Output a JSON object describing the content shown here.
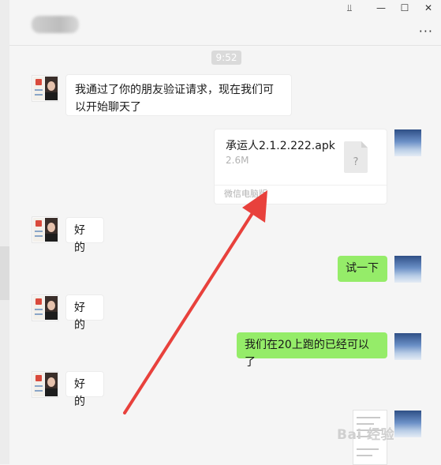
{
  "window": {
    "title": "",
    "controls": {
      "pin": "⫫",
      "minimize": "—",
      "maximize": "☐",
      "close": "✕"
    },
    "more_label": "···"
  },
  "chat": {
    "timestamp": "9:52",
    "messages": [
      {
        "from": "friend",
        "type": "text",
        "text": "我通过了你的朋友验证请求，现在我们可以开始聊天了"
      },
      {
        "from": "me",
        "type": "file",
        "file_name": "承运人2.1.2.222.apk",
        "file_size": "2.6M",
        "source": "微信电脑版",
        "icon": "?"
      },
      {
        "from": "friend",
        "type": "text",
        "text": "好的"
      },
      {
        "from": "me",
        "type": "text",
        "text": "试一下"
      },
      {
        "from": "friend",
        "type": "text",
        "text": "好的"
      },
      {
        "from": "me",
        "type": "text",
        "text": "我们在20上跑的已经可以了"
      },
      {
        "from": "friend",
        "type": "text",
        "text": "好的"
      },
      {
        "from": "me",
        "type": "image"
      }
    ]
  },
  "watermark": "Bai 经验",
  "colors": {
    "outgoing_bubble": "#95ec69",
    "incoming_bubble": "#ffffff",
    "background": "#f5f5f5",
    "annotation_arrow": "#e8413c"
  }
}
